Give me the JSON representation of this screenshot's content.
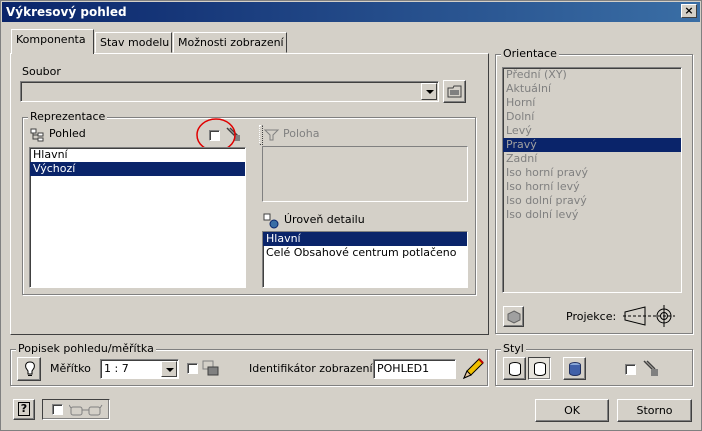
{
  "window": {
    "title": "Výkresový pohled",
    "close_label": "×"
  },
  "tabs": [
    {
      "label": "Komponenta"
    },
    {
      "label": "Stav modelu"
    },
    {
      "label": "Možnosti zobrazení"
    }
  ],
  "file": {
    "label": "Soubor",
    "value": ""
  },
  "representation": {
    "group_label": "Reprezentace",
    "view_label": "Pohled",
    "view_items": [
      "Hlavní",
      "Výchozí"
    ],
    "view_selected": 1,
    "position_label": "Poloha",
    "detail_label": "Úroveň detailu",
    "detail_items": [
      "Hlavní",
      "Celé Obsahové centrum potlačeno"
    ],
    "detail_selected": 0
  },
  "orientation": {
    "group_label": "Orientace",
    "items": [
      "Přední (XY)",
      "Aktuální",
      "Horní",
      "Dolní",
      "Levý",
      "Pravý",
      "Zadní",
      "Iso horní pravý",
      "Iso horní levý",
      "Iso dolní pravý",
      "Iso dolní levý"
    ],
    "selected": 5,
    "projection_label": "Projekce:"
  },
  "label_scale": {
    "group_label": "Popisek pohledu/měřítka",
    "scale_label": "Měřítko",
    "scale_value": "1 : 7",
    "identifier_label": "Identifikátor zobrazení",
    "identifier_value": "POHLED1"
  },
  "style": {
    "group_label": "Styl"
  },
  "buttons": {
    "ok": "OK",
    "cancel": "Storno",
    "help": "?"
  },
  "colors": {
    "selection": "#0a246a",
    "highlight_circle": "#e00000"
  }
}
